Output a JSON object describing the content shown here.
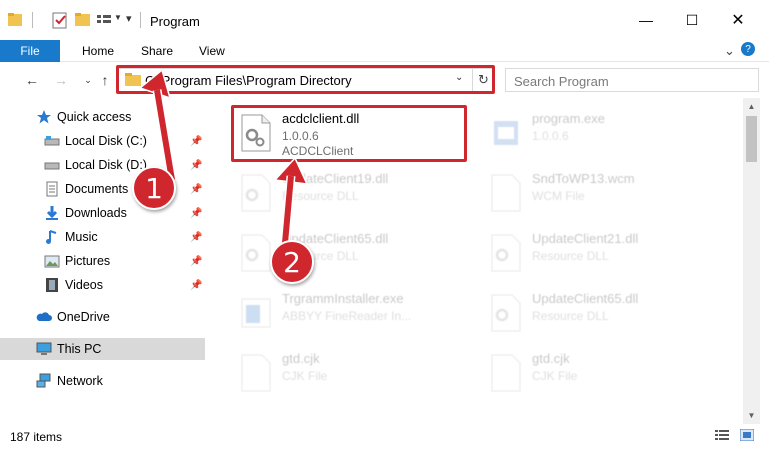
{
  "window": {
    "title": "Program",
    "controls": {
      "minimize": "—",
      "maximize": "☐",
      "close": "✕"
    }
  },
  "ribbon": {
    "tabs": [
      "File",
      "Home",
      "Share",
      "View"
    ],
    "help_glyph": "?",
    "expand_glyph": "⌄"
  },
  "address": {
    "path": "C:\\Program Files\\Program Directory",
    "search_placeholder": "Search Program"
  },
  "nav_pane": {
    "items": [
      {
        "label": "Quick access",
        "icon": "star-icon",
        "pinned": false,
        "selected": false
      },
      {
        "label": "Local Disk (C:)",
        "icon": "drive-icon",
        "pinned": true,
        "selected": false
      },
      {
        "label": "Local Disk (D:)",
        "icon": "drive-icon",
        "pinned": true,
        "selected": false
      },
      {
        "label": "Documents",
        "icon": "documents-icon",
        "pinned": true,
        "selected": false
      },
      {
        "label": "Downloads",
        "icon": "download-icon",
        "pinned": true,
        "selected": false
      },
      {
        "label": "Music",
        "icon": "music-icon",
        "pinned": true,
        "selected": false
      },
      {
        "label": "Pictures",
        "icon": "pictures-icon",
        "pinned": true,
        "selected": false
      },
      {
        "label": "Videos",
        "icon": "videos-icon",
        "pinned": true,
        "selected": false
      },
      {
        "label": "OneDrive",
        "icon": "cloud-icon",
        "pinned": false,
        "selected": false
      },
      {
        "label": "This PC",
        "icon": "computer-icon",
        "pinned": false,
        "selected": true
      },
      {
        "label": "Network",
        "icon": "network-icon",
        "pinned": false,
        "selected": false
      }
    ]
  },
  "files": [
    {
      "name": "acdclclient.dll",
      "line1": "1.0.0.6",
      "line2": "ACDCLClient",
      "type": "dll",
      "highlighted": true
    },
    {
      "name": "program.exe",
      "line1": "1.0.0.6",
      "line2": "",
      "type": "exe",
      "highlighted": false
    },
    {
      "name": "UpdateClient19.dll",
      "line1": "Resource DLL",
      "line2": "",
      "type": "dll",
      "highlighted": false
    },
    {
      "name": "SndToWP13.wcm",
      "line1": "WCM File",
      "line2": "",
      "type": "blank",
      "highlighted": false
    },
    {
      "name": "UpdateClient65.dll",
      "line1": "Resource DLL",
      "line2": "",
      "type": "dll",
      "highlighted": false
    },
    {
      "name": "UpdateClient21.dll",
      "line1": "Resource DLL",
      "line2": "",
      "type": "dll",
      "highlighted": false
    },
    {
      "name": "TrgrammInstaller.exe",
      "line1": "ABBYY FineReader In...",
      "line2": "",
      "type": "installer",
      "highlighted": false
    },
    {
      "name": "UpdateClient65.dll",
      "line1": "Resource DLL",
      "line2": "",
      "type": "dll",
      "highlighted": false
    },
    {
      "name": "gtd.cjk",
      "line1": "CJK File",
      "line2": "",
      "type": "blank",
      "highlighted": false
    },
    {
      "name": "gtd.cjk",
      "line1": "CJK File",
      "line2": "",
      "type": "blank",
      "highlighted": false
    }
  ],
  "status": {
    "item_count": "187 items"
  },
  "callouts": [
    {
      "label": "1",
      "target": "address-bar"
    },
    {
      "label": "2",
      "target": "acdclclient-dll-file"
    }
  ],
  "colors": {
    "accent": "#1979ca",
    "highlight": "#d0262e",
    "selected": "#d9d9d9"
  }
}
